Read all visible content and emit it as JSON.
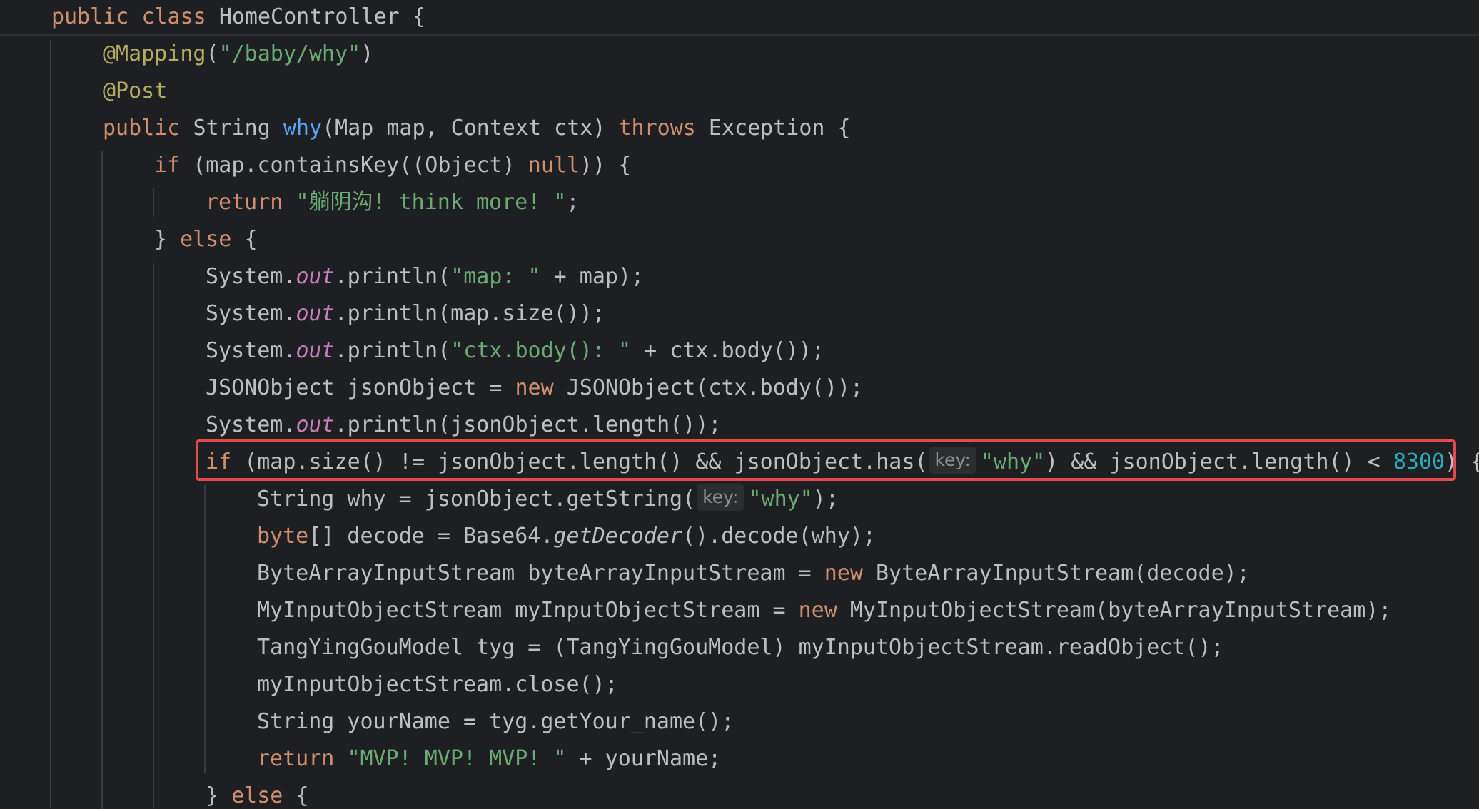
{
  "editor": {
    "theme_colors": {
      "background": "#1e1f22",
      "default_text": "#bcbec4",
      "keyword": "#cf8e6d",
      "annotation": "#b3ae60",
      "string": "#6aab73",
      "method_declaration": "#56a8f5",
      "static_field": "#c77dbb",
      "number": "#2aacb8",
      "inlay_hint_text": "#8c8f94",
      "highlight_box": "#e5484d"
    },
    "highlighted_line_index": 12,
    "lines": [
      {
        "indent": 1,
        "tokens": [
          [
            "kw",
            "public "
          ],
          [
            "kw",
            "class "
          ],
          [
            "df",
            "HomeController {"
          ]
        ]
      },
      {
        "indent": 2,
        "tokens": [
          [
            "ann",
            "@Mapping"
          ],
          [
            "df",
            "("
          ],
          [
            "str",
            "\"/baby/why\""
          ],
          [
            "df",
            ")"
          ]
        ]
      },
      {
        "indent": 2,
        "tokens": [
          [
            "ann",
            "@Post"
          ]
        ]
      },
      {
        "indent": 2,
        "tokens": [
          [
            "kw",
            "public "
          ],
          [
            "df",
            "String "
          ],
          [
            "fn",
            "why"
          ],
          [
            "df",
            "(Map map, Context ctx) "
          ],
          [
            "kw",
            "throws "
          ],
          [
            "df",
            "Exception {"
          ]
        ]
      },
      {
        "indent": 3,
        "tokens": [
          [
            "kw",
            "if "
          ],
          [
            "df",
            "(map.containsKey((Object) "
          ],
          [
            "kw",
            "null"
          ],
          [
            "df",
            ")) {"
          ]
        ]
      },
      {
        "indent": 4,
        "tokens": [
          [
            "kw",
            "return "
          ],
          [
            "str",
            "\"躺阴沟! think more! \""
          ],
          [
            "df",
            ";"
          ]
        ]
      },
      {
        "indent": 3,
        "tokens": [
          [
            "df",
            "} "
          ],
          [
            "kw",
            "else "
          ],
          [
            "df",
            "{"
          ]
        ]
      },
      {
        "indent": 4,
        "tokens": [
          [
            "df",
            "System."
          ],
          [
            "sf",
            "out"
          ],
          [
            "df",
            ".println("
          ],
          [
            "str",
            "\"map: \""
          ],
          [
            "df",
            " + map);"
          ]
        ]
      },
      {
        "indent": 4,
        "tokens": [
          [
            "df",
            "System."
          ],
          [
            "sf",
            "out"
          ],
          [
            "df",
            ".println(map.size());"
          ]
        ]
      },
      {
        "indent": 4,
        "tokens": [
          [
            "df",
            "System."
          ],
          [
            "sf",
            "out"
          ],
          [
            "df",
            ".println("
          ],
          [
            "str",
            "\"ctx.body(): \""
          ],
          [
            "df",
            " + ctx.body());"
          ]
        ]
      },
      {
        "indent": 4,
        "tokens": [
          [
            "df",
            "JSONObject jsonObject = "
          ],
          [
            "kw",
            "new "
          ],
          [
            "df",
            "JSONObject(ctx.body());"
          ]
        ]
      },
      {
        "indent": 4,
        "tokens": [
          [
            "df",
            "System."
          ],
          [
            "sf",
            "out"
          ],
          [
            "df",
            ".println(jsonObject.length());"
          ]
        ]
      },
      {
        "indent": 4,
        "tokens": [
          [
            "kw",
            "if "
          ],
          [
            "df",
            "(map.size() != jsonObject.length() && jsonObject.has("
          ],
          [
            "hint",
            "key:"
          ],
          [
            "str",
            "\"why\""
          ],
          [
            "df",
            ") && jsonObject.length() < "
          ],
          [
            "num",
            "8300"
          ],
          [
            "df",
            ") {"
          ]
        ]
      },
      {
        "indent": 5,
        "tokens": [
          [
            "df",
            "String why = jsonObject.getString("
          ],
          [
            "hint",
            "key:"
          ],
          [
            "str",
            "\"why\""
          ],
          [
            "df",
            ");"
          ]
        ]
      },
      {
        "indent": 5,
        "tokens": [
          [
            "kw",
            "byte"
          ],
          [
            "df",
            "[] decode = Base64."
          ],
          [
            "sm",
            "getDecoder"
          ],
          [
            "df",
            "().decode(why);"
          ]
        ]
      },
      {
        "indent": 5,
        "tokens": [
          [
            "df",
            "ByteArrayInputStream byteArrayInputStream = "
          ],
          [
            "kw",
            "new "
          ],
          [
            "df",
            "ByteArrayInputStream(decode);"
          ]
        ]
      },
      {
        "indent": 5,
        "tokens": [
          [
            "df",
            "MyInputObjectStream myInputObjectStream = "
          ],
          [
            "kw",
            "new "
          ],
          [
            "df",
            "MyInputObjectStream(byteArrayInputStream);"
          ]
        ]
      },
      {
        "indent": 5,
        "tokens": [
          [
            "df",
            "TangYingGouModel tyg = (TangYingGouModel) myInputObjectStream.readObject();"
          ]
        ]
      },
      {
        "indent": 5,
        "tokens": [
          [
            "df",
            "myInputObjectStream.close();"
          ]
        ]
      },
      {
        "indent": 5,
        "tokens": [
          [
            "df",
            "String yourName = tyg.getYour_name();"
          ]
        ]
      },
      {
        "indent": 5,
        "tokens": [
          [
            "kw",
            "return "
          ],
          [
            "str",
            "\"MVP! MVP! MVP! \""
          ],
          [
            "df",
            " + yourName;"
          ]
        ]
      },
      {
        "indent": 4,
        "tokens": [
          [
            "df",
            "} "
          ],
          [
            "kw",
            "else "
          ],
          [
            "df",
            "{"
          ]
        ]
      }
    ]
  }
}
